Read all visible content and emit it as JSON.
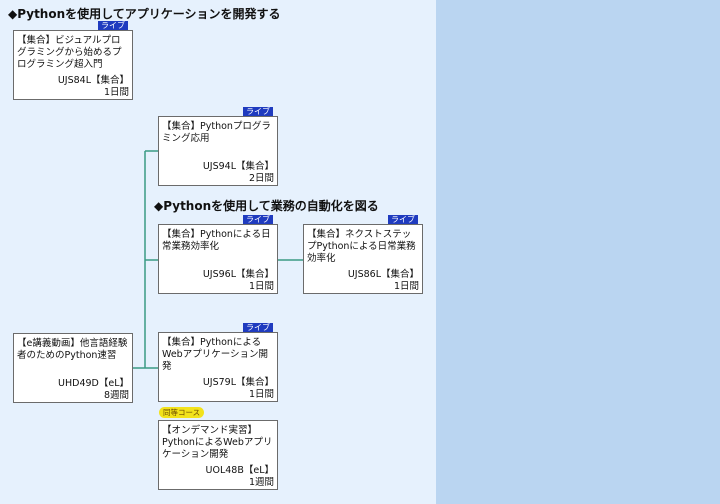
{
  "headings": {
    "main": "◆Pythonを使用してアプリケーションを開発する",
    "sub": "◆Pythonを使用して業務の自動化を図る"
  },
  "badges": {
    "live": "ライブ",
    "equivalent": "同等コース"
  },
  "courses": {
    "c1": {
      "title": "【集合】ビジュアルプログラミングから始めるプログラミング超入門",
      "code": "UJS84L【集合】",
      "duration": "1日間"
    },
    "c2": {
      "title": "【集合】Pythonプログラミング応用",
      "code": "UJS94L【集合】",
      "duration": "2日間"
    },
    "c3": {
      "title": "【集合】Pythonによる日常業務効率化",
      "code": "UJS96L【集合】",
      "duration": "1日間"
    },
    "c4": {
      "title": "【集合】ネクストステップPythonによる日常業務効率化",
      "code": "UJS86L【集合】",
      "duration": "1日間"
    },
    "c5": {
      "title": "【e講義動画】他言語経験者のためのPython速習",
      "code": "UHD49D【eL】",
      "duration": "8週間"
    },
    "c6": {
      "title": "【集合】PythonによるWebアプリケーション開発",
      "code": "UJS79L【集合】",
      "duration": "1日間"
    },
    "c7": {
      "title": "【オンデマンド実習】PythonによるWebアプリケーション開発",
      "code": "UOL48B【eL】",
      "duration": "1週間"
    }
  },
  "colors": {
    "connector": "#3a9a84",
    "live_badge": "#1f3bbf",
    "equiv_badge": "#f2e21b"
  }
}
